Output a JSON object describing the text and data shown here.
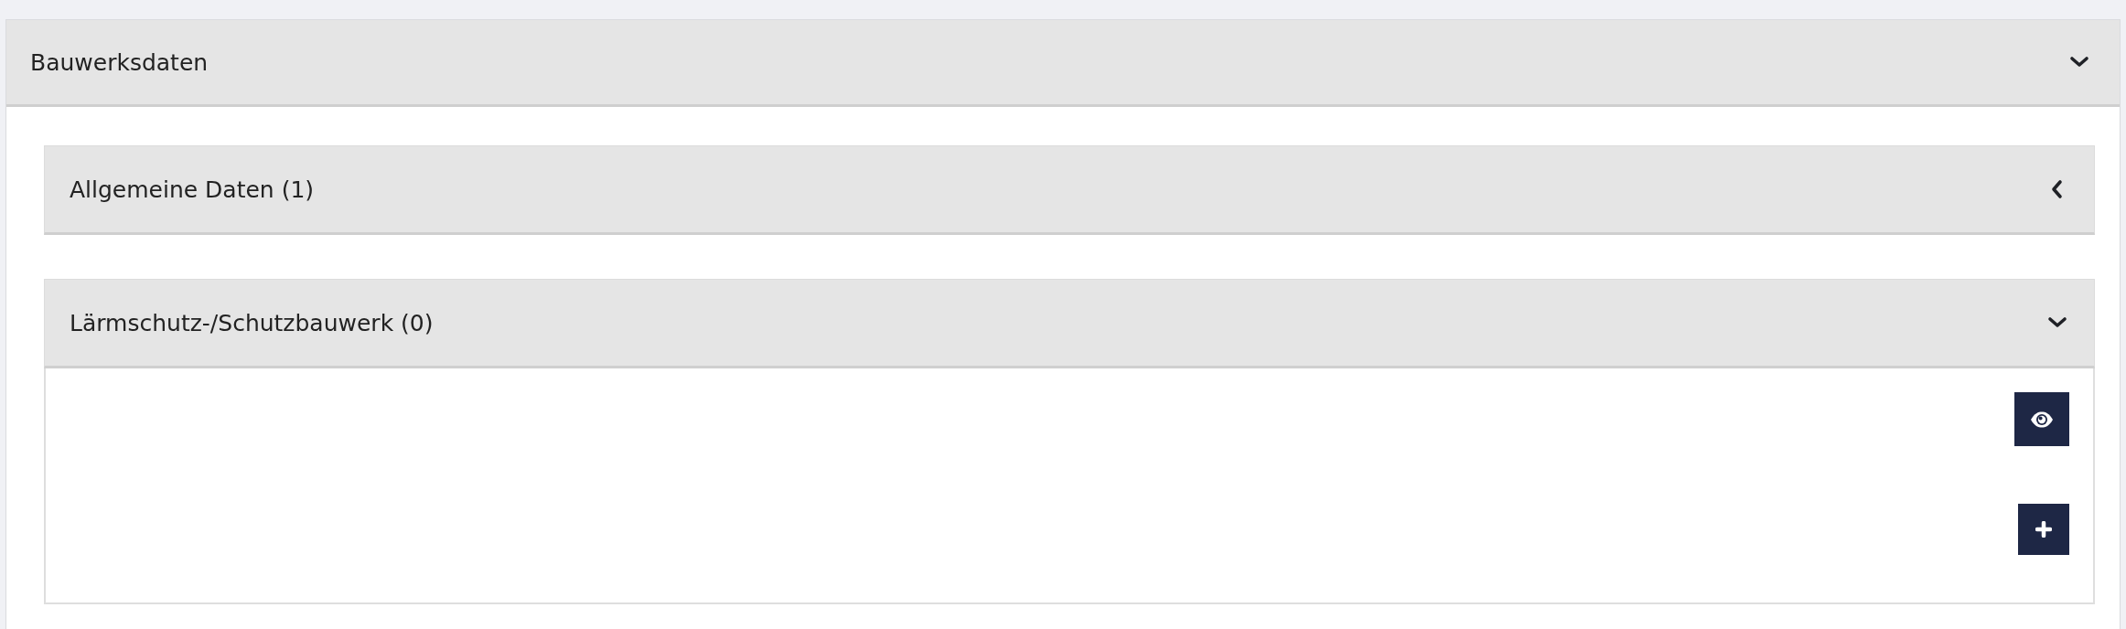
{
  "panel": {
    "title": "Bauwerksdaten",
    "expanded": true,
    "sections": [
      {
        "title": "Allgemeine Daten (1)",
        "expanded": false
      },
      {
        "title": "Lärmschutz-/Schutzbauwerk (0)",
        "expanded": true,
        "actions": [
          {
            "kind": "view"
          },
          {
            "kind": "add"
          }
        ]
      }
    ]
  }
}
